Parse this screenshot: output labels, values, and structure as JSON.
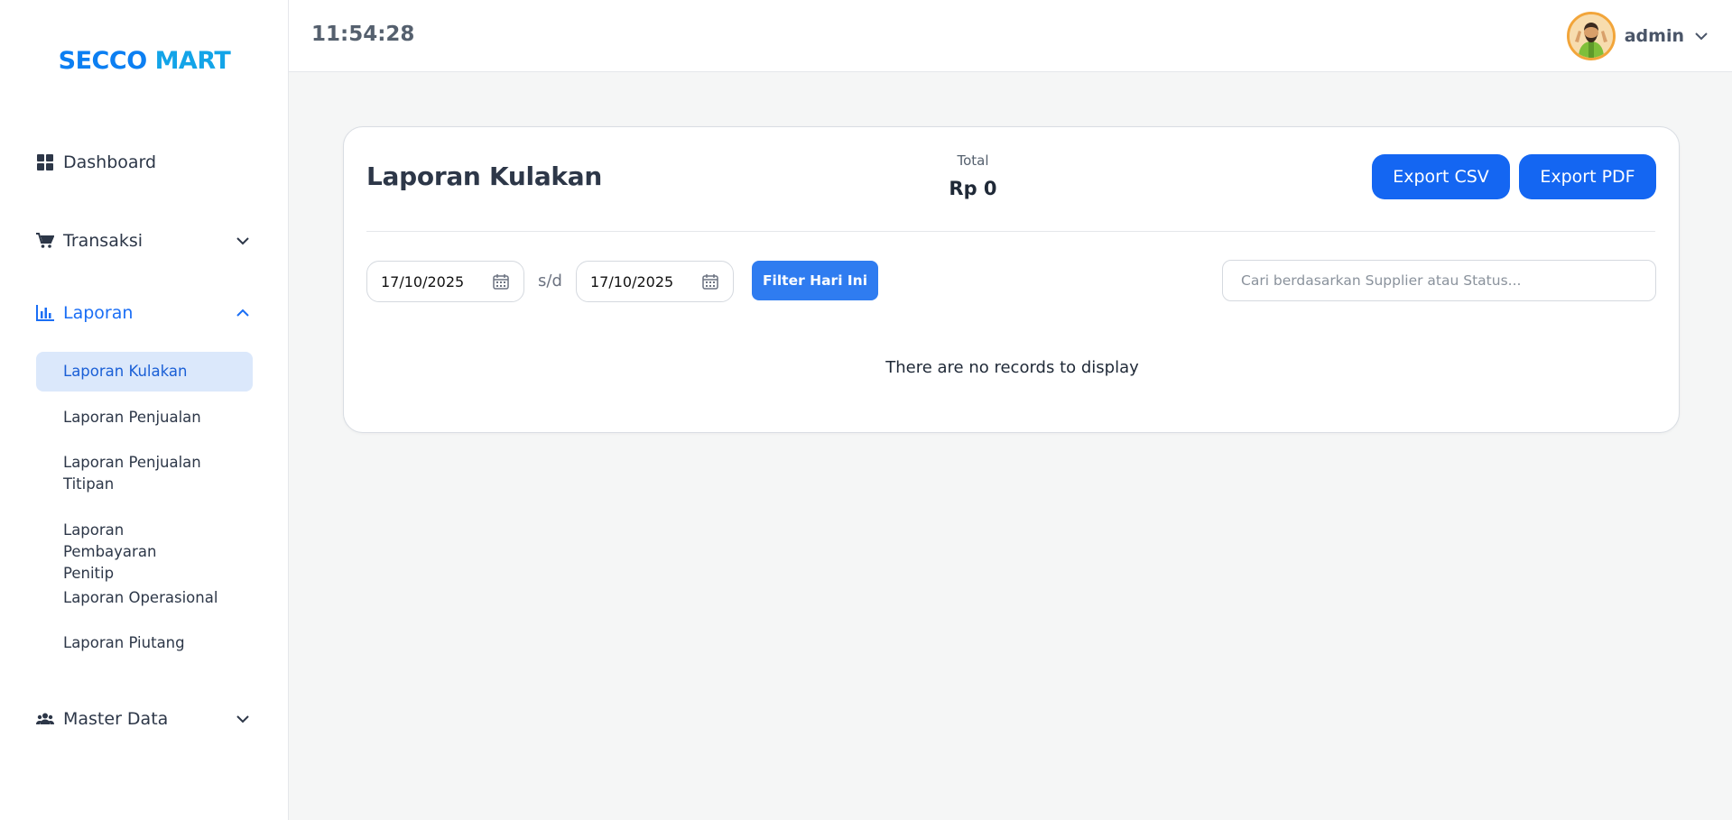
{
  "brand": {
    "name_part1": "SECCO",
    "name_part2": "MART"
  },
  "header": {
    "clock": "11:54:28",
    "username": "admin"
  },
  "sidebar": {
    "items": [
      {
        "label": "Dashboard",
        "icon": "grid-icon"
      },
      {
        "label": "Transaksi",
        "icon": "cart-icon",
        "expanded": false
      },
      {
        "label": "Laporan",
        "icon": "chart-icon",
        "expanded": true
      },
      {
        "label": "Master Data",
        "icon": "users-icon",
        "expanded": false
      }
    ],
    "laporan_sub": [
      {
        "label": "Laporan Kulakan",
        "active": true
      },
      {
        "label": "Laporan Penjualan"
      },
      {
        "label": "Laporan Penjualan Titipan"
      },
      {
        "label": "Laporan Pembayaran Penitip"
      },
      {
        "label": "Laporan Operasional"
      },
      {
        "label": "Laporan Piutang"
      }
    ]
  },
  "report": {
    "title": "Laporan Kulakan",
    "total_label": "Total",
    "total_value": "Rp 0",
    "export_csv": "Export CSV",
    "export_pdf": "Export PDF",
    "date_from": "17/10/2025",
    "date_separator": "s/d",
    "date_to": "17/10/2025",
    "filter_today": "Filter Hari Ini",
    "search_placeholder": "Cari berdasarkan Supplier atau Status...",
    "empty_message": "There are no records to display"
  },
  "colors": {
    "accent": "#1466f2",
    "active_bg": "#dbe8fb",
    "brand": "#0c7ff2"
  }
}
